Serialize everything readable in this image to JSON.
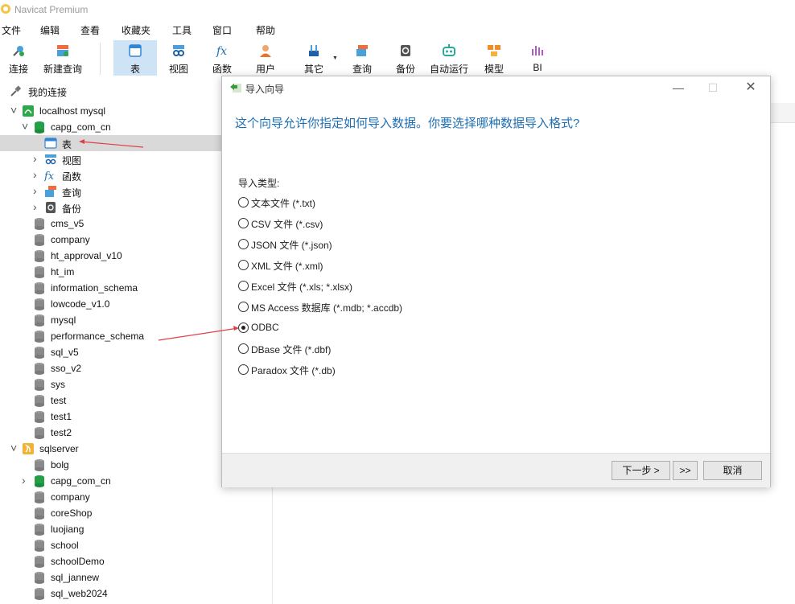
{
  "app": {
    "title": "Navicat Premium"
  },
  "menu": [
    "文件",
    "编辑",
    "查看",
    "收藏夹",
    "工具",
    "窗口",
    "帮助"
  ],
  "toolbar": {
    "items": [
      {
        "label": "连接",
        "icon": "connect-icon"
      },
      {
        "label": "新建查询",
        "icon": "new-query-icon"
      },
      {
        "label": "表",
        "icon": "table-icon",
        "active": true
      },
      {
        "label": "视图",
        "icon": "view-icon"
      },
      {
        "label": "函数",
        "icon": "function-icon"
      },
      {
        "label": "用户",
        "icon": "user-icon"
      },
      {
        "label": "其它",
        "icon": "other-icon"
      },
      {
        "label": "查询",
        "icon": "query-icon"
      },
      {
        "label": "备份",
        "icon": "backup-icon"
      },
      {
        "label": "自动运行",
        "icon": "auto-run-icon"
      },
      {
        "label": "模型",
        "icon": "model-icon"
      },
      {
        "label": "BI",
        "icon": "bi-icon"
      }
    ]
  },
  "sidebar": {
    "root_label": "我的连接",
    "rows": [
      {
        "text": "localhost mysql",
        "type": "connection-mysql"
      },
      {
        "text": "capg_com_cn",
        "type": "db-open"
      },
      {
        "text": "表",
        "type": "tables",
        "selected": true
      },
      {
        "text": "视图",
        "type": "views"
      },
      {
        "text": "函数",
        "type": "functions"
      },
      {
        "text": "查询",
        "type": "queries"
      },
      {
        "text": "备份",
        "type": "backups"
      },
      {
        "text": "cms_v5",
        "type": "db"
      },
      {
        "text": "company",
        "type": "db"
      },
      {
        "text": "ht_approval_v10",
        "type": "db"
      },
      {
        "text": "ht_im",
        "type": "db"
      },
      {
        "text": "information_schema",
        "type": "db"
      },
      {
        "text": "lowcode_v1.0",
        "type": "db"
      },
      {
        "text": "mysql",
        "type": "db"
      },
      {
        "text": "performance_schema",
        "type": "db"
      },
      {
        "text": "sql_v5",
        "type": "db"
      },
      {
        "text": "sso_v2",
        "type": "db"
      },
      {
        "text": "sys",
        "type": "db"
      },
      {
        "text": "test",
        "type": "db"
      },
      {
        "text": "test1",
        "type": "db"
      },
      {
        "text": "test2",
        "type": "db"
      },
      {
        "text": "sqlserver",
        "type": "connection-sqlserver"
      },
      {
        "text": "bolg",
        "type": "db"
      },
      {
        "text": "capg_com_cn",
        "type": "db-green"
      },
      {
        "text": "company",
        "type": "db"
      },
      {
        "text": "coreShop",
        "type": "db"
      },
      {
        "text": "luojiang",
        "type": "db"
      },
      {
        "text": "school",
        "type": "db"
      },
      {
        "text": "schoolDemo",
        "type": "db"
      },
      {
        "text": "sql_jannew",
        "type": "db"
      },
      {
        "text": "sql_web2024",
        "type": "db"
      }
    ]
  },
  "dialog": {
    "title": "导入向导",
    "heading": "这个向导允许你指定如何导入数据。你要选择哪种数据导入格式?",
    "type_label": "导入类型:",
    "options": [
      {
        "label": "文本文件 (*.txt)",
        "checked": false
      },
      {
        "label": "CSV 文件 (*.csv)",
        "checked": false
      },
      {
        "label": "JSON 文件 (*.json)",
        "checked": false
      },
      {
        "label": "XML 文件 (*.xml)",
        "checked": false
      },
      {
        "label": "Excel 文件 (*.xls; *.xlsx)",
        "checked": false
      },
      {
        "label": "MS Access 数据库 (*.mdb; *.accdb)",
        "checked": false
      },
      {
        "label": "ODBC",
        "checked": true
      },
      {
        "label": "DBase 文件 (*.dbf)",
        "checked": false
      },
      {
        "label": "Paradox 文件 (*.db)",
        "checked": false
      }
    ],
    "buttons": {
      "next": "下一步 >",
      "last": ">>",
      "cancel": "取消"
    }
  },
  "colors": {
    "heading": "#1e6fb3",
    "annotation": "#e0404a",
    "selected_tab": "#cfe3f7"
  }
}
